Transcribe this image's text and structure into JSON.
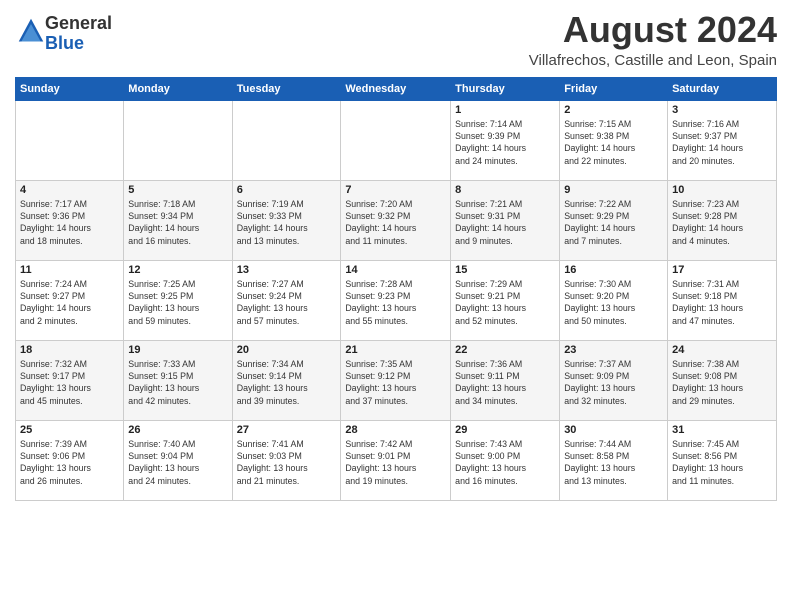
{
  "logo": {
    "general": "General",
    "blue": "Blue"
  },
  "title": "August 2024",
  "subtitle": "Villafrechos, Castille and Leon, Spain",
  "header_days": [
    "Sunday",
    "Monday",
    "Tuesday",
    "Wednesday",
    "Thursday",
    "Friday",
    "Saturday"
  ],
  "weeks": [
    [
      {
        "day": "",
        "info": ""
      },
      {
        "day": "",
        "info": ""
      },
      {
        "day": "",
        "info": ""
      },
      {
        "day": "",
        "info": ""
      },
      {
        "day": "1",
        "info": "Sunrise: 7:14 AM\nSunset: 9:39 PM\nDaylight: 14 hours\nand 24 minutes."
      },
      {
        "day": "2",
        "info": "Sunrise: 7:15 AM\nSunset: 9:38 PM\nDaylight: 14 hours\nand 22 minutes."
      },
      {
        "day": "3",
        "info": "Sunrise: 7:16 AM\nSunset: 9:37 PM\nDaylight: 14 hours\nand 20 minutes."
      }
    ],
    [
      {
        "day": "4",
        "info": "Sunrise: 7:17 AM\nSunset: 9:36 PM\nDaylight: 14 hours\nand 18 minutes."
      },
      {
        "day": "5",
        "info": "Sunrise: 7:18 AM\nSunset: 9:34 PM\nDaylight: 14 hours\nand 16 minutes."
      },
      {
        "day": "6",
        "info": "Sunrise: 7:19 AM\nSunset: 9:33 PM\nDaylight: 14 hours\nand 13 minutes."
      },
      {
        "day": "7",
        "info": "Sunrise: 7:20 AM\nSunset: 9:32 PM\nDaylight: 14 hours\nand 11 minutes."
      },
      {
        "day": "8",
        "info": "Sunrise: 7:21 AM\nSunset: 9:31 PM\nDaylight: 14 hours\nand 9 minutes."
      },
      {
        "day": "9",
        "info": "Sunrise: 7:22 AM\nSunset: 9:29 PM\nDaylight: 14 hours\nand 7 minutes."
      },
      {
        "day": "10",
        "info": "Sunrise: 7:23 AM\nSunset: 9:28 PM\nDaylight: 14 hours\nand 4 minutes."
      }
    ],
    [
      {
        "day": "11",
        "info": "Sunrise: 7:24 AM\nSunset: 9:27 PM\nDaylight: 14 hours\nand 2 minutes."
      },
      {
        "day": "12",
        "info": "Sunrise: 7:25 AM\nSunset: 9:25 PM\nDaylight: 13 hours\nand 59 minutes."
      },
      {
        "day": "13",
        "info": "Sunrise: 7:27 AM\nSunset: 9:24 PM\nDaylight: 13 hours\nand 57 minutes."
      },
      {
        "day": "14",
        "info": "Sunrise: 7:28 AM\nSunset: 9:23 PM\nDaylight: 13 hours\nand 55 minutes."
      },
      {
        "day": "15",
        "info": "Sunrise: 7:29 AM\nSunset: 9:21 PM\nDaylight: 13 hours\nand 52 minutes."
      },
      {
        "day": "16",
        "info": "Sunrise: 7:30 AM\nSunset: 9:20 PM\nDaylight: 13 hours\nand 50 minutes."
      },
      {
        "day": "17",
        "info": "Sunrise: 7:31 AM\nSunset: 9:18 PM\nDaylight: 13 hours\nand 47 minutes."
      }
    ],
    [
      {
        "day": "18",
        "info": "Sunrise: 7:32 AM\nSunset: 9:17 PM\nDaylight: 13 hours\nand 45 minutes."
      },
      {
        "day": "19",
        "info": "Sunrise: 7:33 AM\nSunset: 9:15 PM\nDaylight: 13 hours\nand 42 minutes."
      },
      {
        "day": "20",
        "info": "Sunrise: 7:34 AM\nSunset: 9:14 PM\nDaylight: 13 hours\nand 39 minutes."
      },
      {
        "day": "21",
        "info": "Sunrise: 7:35 AM\nSunset: 9:12 PM\nDaylight: 13 hours\nand 37 minutes."
      },
      {
        "day": "22",
        "info": "Sunrise: 7:36 AM\nSunset: 9:11 PM\nDaylight: 13 hours\nand 34 minutes."
      },
      {
        "day": "23",
        "info": "Sunrise: 7:37 AM\nSunset: 9:09 PM\nDaylight: 13 hours\nand 32 minutes."
      },
      {
        "day": "24",
        "info": "Sunrise: 7:38 AM\nSunset: 9:08 PM\nDaylight: 13 hours\nand 29 minutes."
      }
    ],
    [
      {
        "day": "25",
        "info": "Sunrise: 7:39 AM\nSunset: 9:06 PM\nDaylight: 13 hours\nand 26 minutes."
      },
      {
        "day": "26",
        "info": "Sunrise: 7:40 AM\nSunset: 9:04 PM\nDaylight: 13 hours\nand 24 minutes."
      },
      {
        "day": "27",
        "info": "Sunrise: 7:41 AM\nSunset: 9:03 PM\nDaylight: 13 hours\nand 21 minutes."
      },
      {
        "day": "28",
        "info": "Sunrise: 7:42 AM\nSunset: 9:01 PM\nDaylight: 13 hours\nand 19 minutes."
      },
      {
        "day": "29",
        "info": "Sunrise: 7:43 AM\nSunset: 9:00 PM\nDaylight: 13 hours\nand 16 minutes."
      },
      {
        "day": "30",
        "info": "Sunrise: 7:44 AM\nSunset: 8:58 PM\nDaylight: 13 hours\nand 13 minutes."
      },
      {
        "day": "31",
        "info": "Sunrise: 7:45 AM\nSunset: 8:56 PM\nDaylight: 13 hours\nand 11 minutes."
      }
    ]
  ]
}
